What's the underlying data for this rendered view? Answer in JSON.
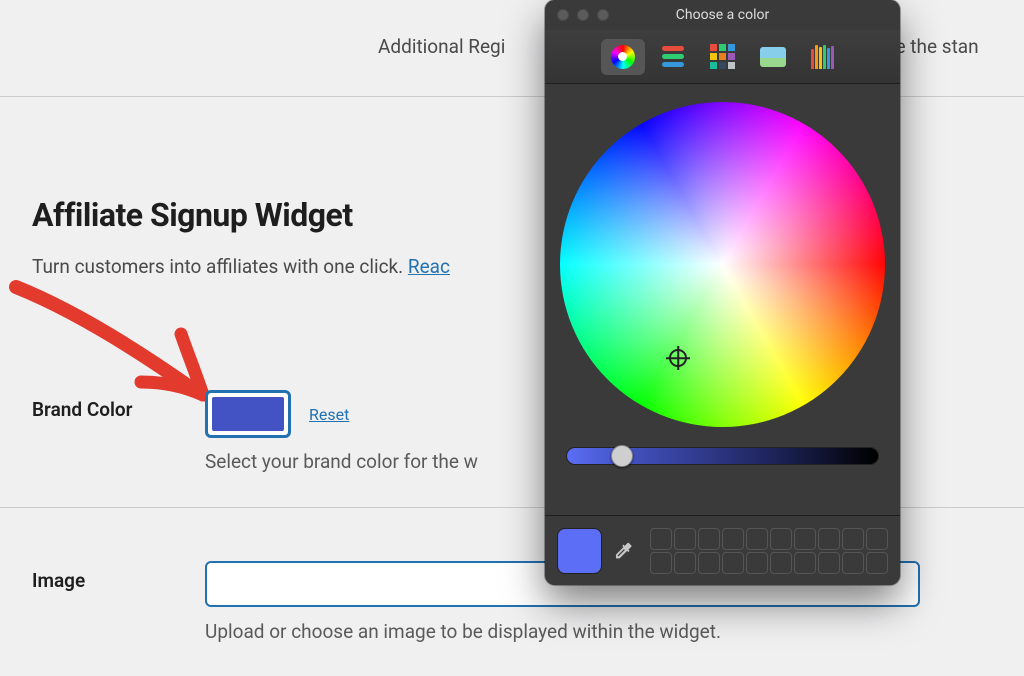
{
  "top": {
    "additional_prefix": "Additional Regi",
    "additional_suffix": "de the stan"
  },
  "section": {
    "heading": "Affiliate Signup Widget",
    "description": "Turn customers into affiliates with one click. ",
    "read_more": "Reac"
  },
  "brand_color": {
    "label": "Brand Color",
    "reset": "Reset",
    "help": "Select your brand color for the w",
    "value": "#4453c4"
  },
  "image": {
    "label": "Image",
    "help": "Upload or choose an image to be displayed within the widget."
  },
  "picker": {
    "title": "Choose a color"
  }
}
